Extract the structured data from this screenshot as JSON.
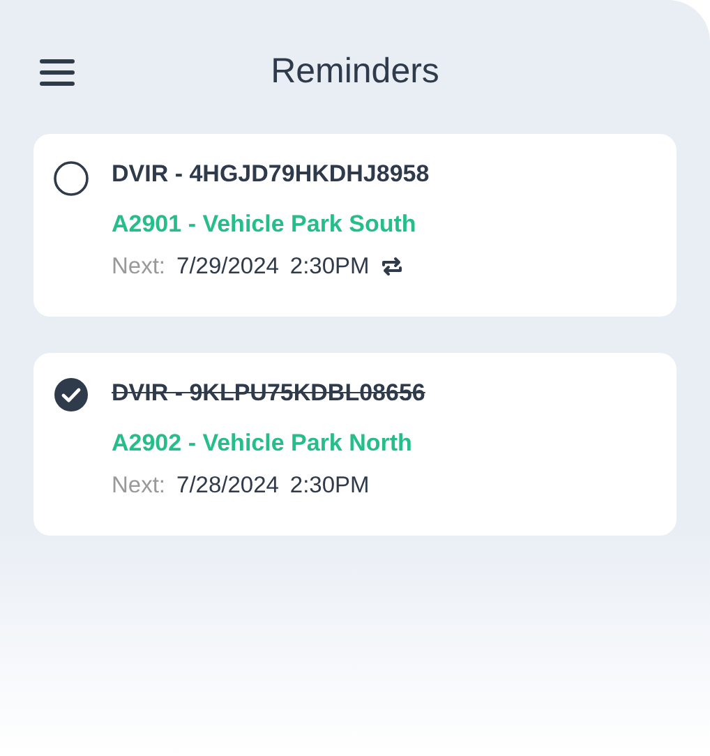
{
  "header": {
    "title": "Reminders"
  },
  "reminders": [
    {
      "title": "DVIR - 4HGJD79HKDHJ8958",
      "checked": false,
      "location": "A2901 - Vehicle Park South",
      "next_label": "Next:",
      "date": "7/29/2024",
      "time": "2:30PM",
      "repeating": true
    },
    {
      "title": "DVIR - 9KLPU75KDBL08656",
      "checked": true,
      "location": "A2902 - Vehicle Park North",
      "next_label": "Next:",
      "date": "7/28/2024",
      "time": "2:30PM",
      "repeating": false
    }
  ]
}
